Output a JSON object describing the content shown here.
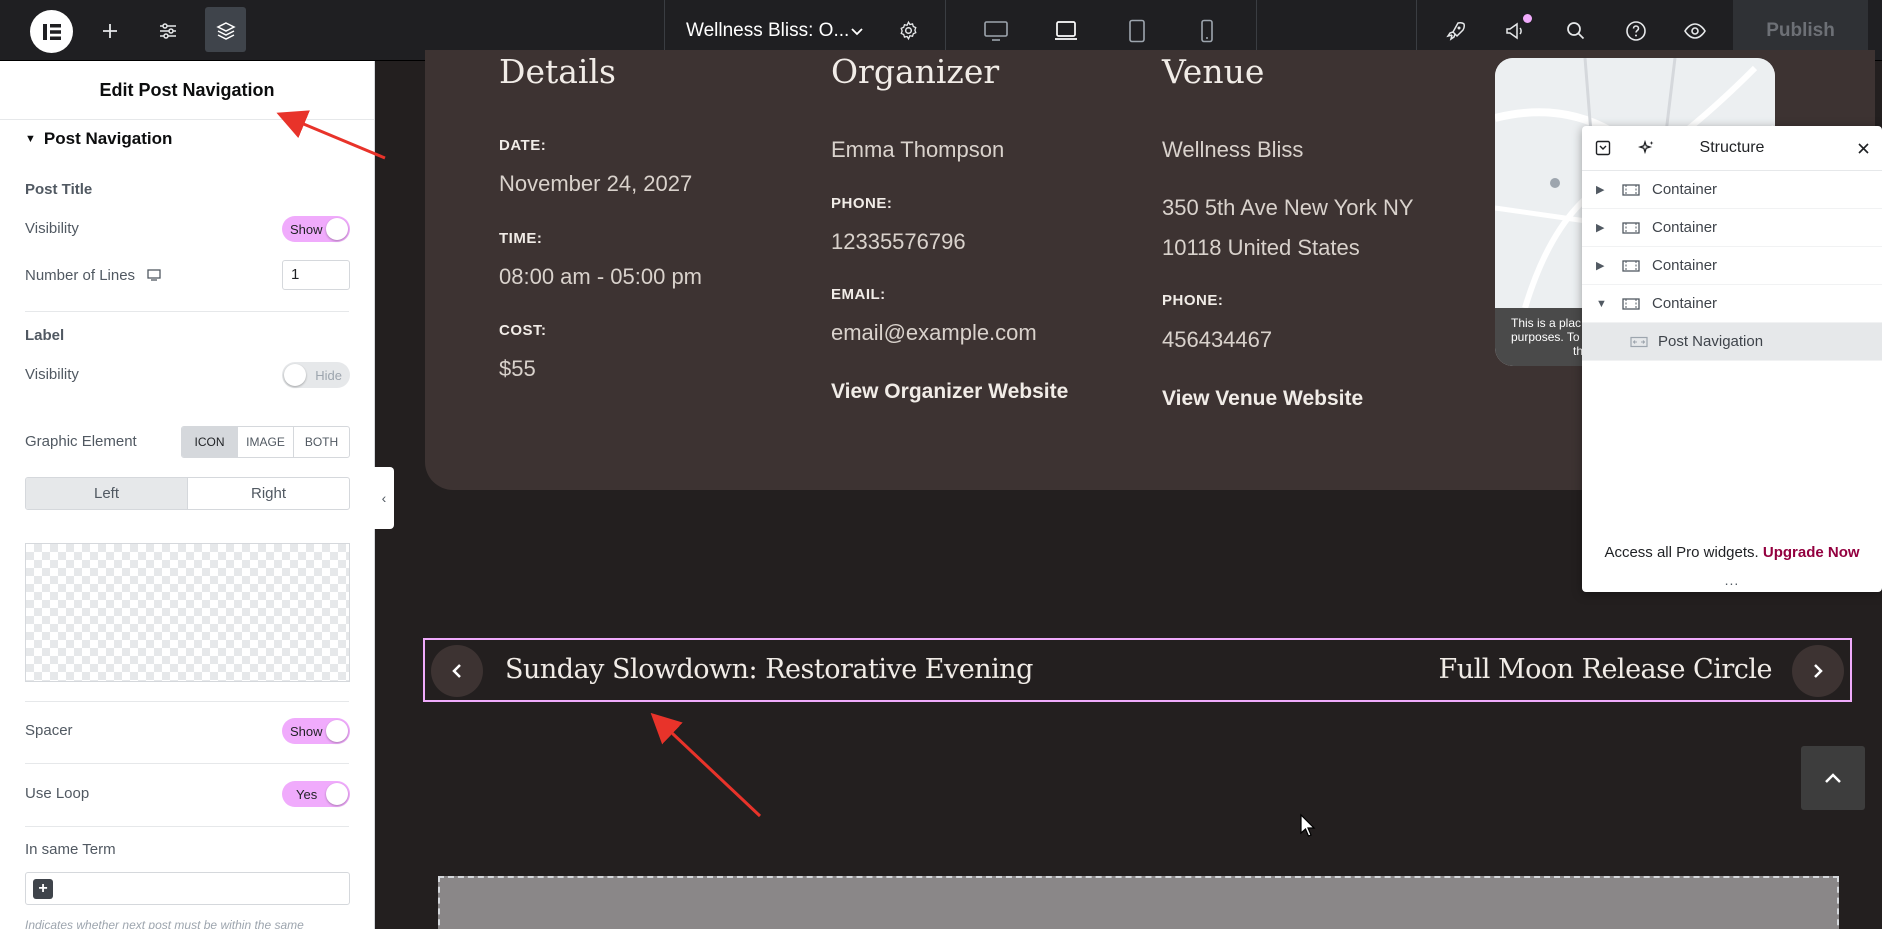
{
  "topbar": {
    "document_title": "Wellness Bliss: O...",
    "publish_label": "Publish",
    "colors": {
      "background": "#1f1f22",
      "accent": "#f0abfc"
    }
  },
  "panel": {
    "title": "Edit Post Navigation",
    "section": "Post Navigation",
    "post_title": {
      "heading": "Post Title",
      "visibility_label": "Visibility",
      "visibility_value": "Show",
      "lines_label": "Number of Lines",
      "lines_value": "1"
    },
    "label": {
      "heading": "Label",
      "visibility_label": "Visibility",
      "visibility_value": "Hide"
    },
    "graphic": {
      "label": "Graphic Element",
      "options": [
        "ICON",
        "IMAGE",
        "BOTH"
      ],
      "selected": "ICON"
    },
    "position": {
      "left": "Left",
      "right": "Right",
      "selected": "Left"
    },
    "spacer": {
      "label": "Spacer",
      "value": "Show"
    },
    "use_loop": {
      "label": "Use Loop",
      "value": "Yes"
    },
    "same_term": {
      "label": "In same Term",
      "hint": "Indicates whether next post must be within the same"
    }
  },
  "event": {
    "details": {
      "title": "Details",
      "date_label": "DATE:",
      "date_value": "November 24, 2027",
      "time_label": "TIME:",
      "time_value": "08:00 am - 05:00 pm",
      "cost_label": "COST:",
      "cost_value": "$55"
    },
    "organizer": {
      "title": "Organizer",
      "name": "Emma Thompson",
      "phone_label": "PHONE:",
      "phone_value": "12335576796",
      "email_label": "EMAIL:",
      "email_value": "email@example.com",
      "website_link": "View Organizer Website"
    },
    "venue": {
      "title": "Venue",
      "name": "Wellness Bliss",
      "address_line1": "350 5th Ave  New York  NY",
      "address_line2": "10118  United States",
      "phone_label": "PHONE:",
      "phone_value": "456434467",
      "website_link": "View Venue Website"
    },
    "map_overlay_text": [
      "This is a plac",
      "purposes. To",
      "the"
    ]
  },
  "post_navigation": {
    "prev_title": "Sunday Slowdown: Restorative Evening",
    "next_title": "Full Moon Release Circle"
  },
  "structure": {
    "title": "Structure",
    "items": [
      {
        "label": "Container",
        "expanded": false
      },
      {
        "label": "Container",
        "expanded": false
      },
      {
        "label": "Container",
        "expanded": false
      },
      {
        "label": "Container",
        "expanded": true
      },
      {
        "label": "Post Navigation",
        "child": true,
        "selected": true
      }
    ],
    "footer_text": "Access all Pro widgets.",
    "footer_link": "Upgrade Now",
    "dots": "..."
  }
}
